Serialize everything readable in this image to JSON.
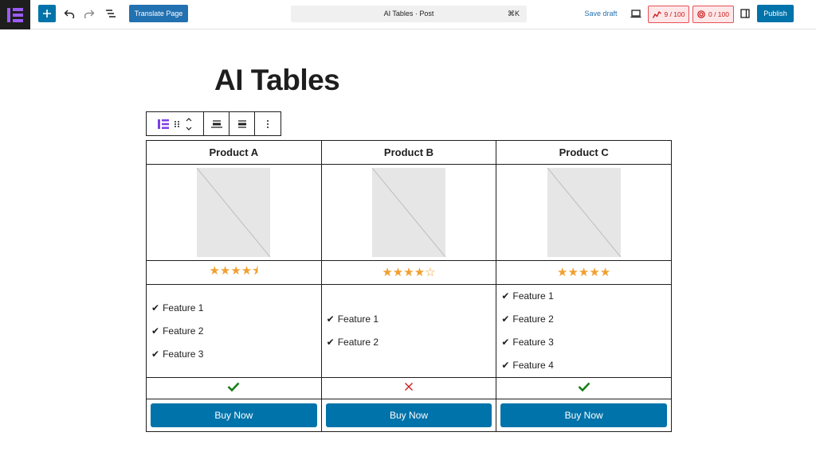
{
  "toolbar": {
    "translate_label": "Translate Page",
    "command_title": "AI Tables · Post",
    "command_shortcut": "⌘K",
    "save_draft_label": "Save draft",
    "seo_score": "9 / 100",
    "readability_score": "0 / 100",
    "publish_label": "Publish"
  },
  "post": {
    "title": "AI Tables"
  },
  "table": {
    "headers": [
      "Product A",
      "Product B",
      "Product C"
    ],
    "ratings": [
      4.5,
      4,
      5
    ],
    "ratings_max": 5,
    "stars": [
      "★★★★⯨",
      "★★★★☆",
      "★★★★★"
    ],
    "features": [
      [
        "Feature 1",
        "Feature 2",
        "Feature 3"
      ],
      [
        "Feature 1",
        "Feature 2"
      ],
      [
        "Feature 1",
        "Feature 2",
        "Feature 3",
        "Feature 4"
      ]
    ],
    "availability": [
      "check",
      "cross",
      "check"
    ],
    "button_label": "Buy Now"
  },
  "colors": {
    "accent": "#0073aa",
    "star": "#f0a030",
    "check": "#1a7f1a",
    "cross": "#cc1818"
  }
}
